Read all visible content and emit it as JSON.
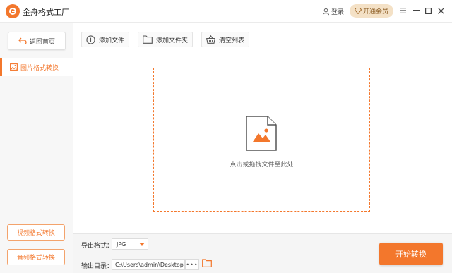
{
  "app": {
    "title": "金舟格式工厂"
  },
  "header": {
    "login_label": "登录",
    "vip_label": "开通会员"
  },
  "sidebar": {
    "back_label": "返回首页",
    "active_item_label": "图片格式转换",
    "bottom_items": [
      {
        "label": "视频格式转换"
      },
      {
        "label": "音频格式转换"
      }
    ]
  },
  "toolbar": {
    "add_file_label": "添加文件",
    "add_folder_label": "添加文件夹",
    "clear_list_label": "清空列表"
  },
  "dropzone": {
    "hint": "点击或拖拽文件至此处"
  },
  "output": {
    "format_label": "导出格式：",
    "format_value": "JPG",
    "dir_label": "输出目录：",
    "dir_value": "C:\\Users\\admin\\Desktop\\",
    "more_label": "•••"
  },
  "start_button_label": "开始转换",
  "colors": {
    "accent": "#f3772c",
    "vip_bg": "#f4e1c6"
  },
  "icons": [
    "logo-icon",
    "user-icon",
    "diamond-icon",
    "menu-icon",
    "minimize-icon",
    "maximize-icon",
    "close-icon",
    "back-arrow-icon",
    "image-icon",
    "plus-circle-icon",
    "folder-icon",
    "basket-icon",
    "image-file-icon"
  ]
}
